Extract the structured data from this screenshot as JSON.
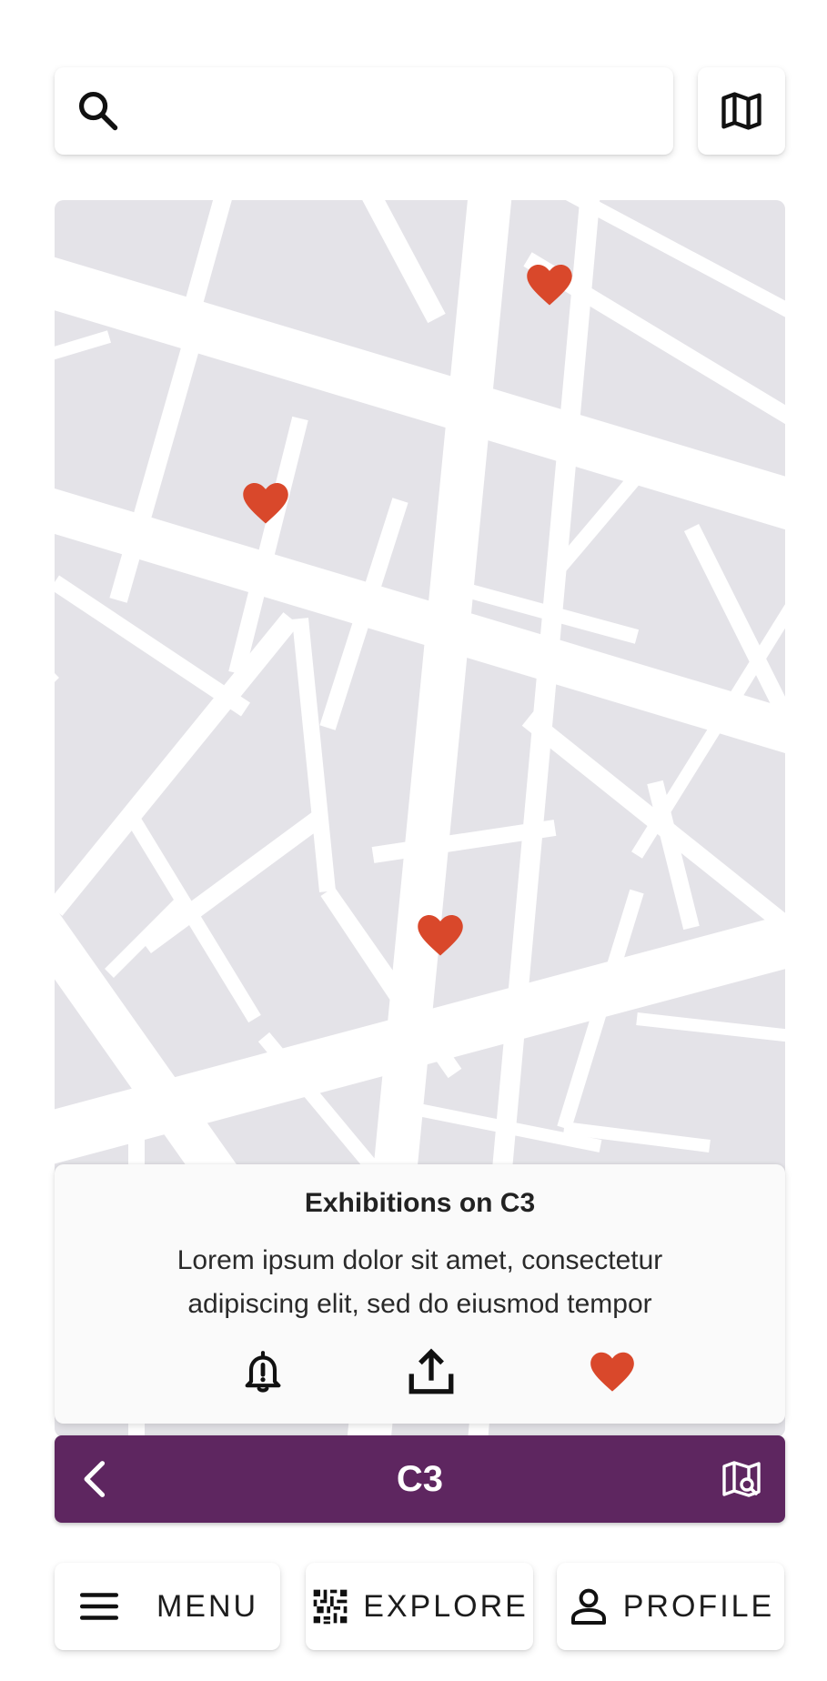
{
  "search": {
    "placeholder": "",
    "value": ""
  },
  "header": {
    "map_toggle_icon": "map-icon"
  },
  "map": {
    "markers": [
      {
        "icon": "heart-icon",
        "color": "#d9482b"
      },
      {
        "icon": "heart-icon",
        "color": "#d9482b"
      },
      {
        "icon": "heart-icon",
        "color": "#d9482b"
      }
    ]
  },
  "info_card": {
    "title": "Exhibitions on C3",
    "description": "Lorem ipsum dolor sit amet, consectetur adipiscing elit, sed do eiusmod tempor",
    "actions": [
      {
        "icon": "bell-alert-icon"
      },
      {
        "icon": "share-upload-icon"
      },
      {
        "icon": "heart-icon",
        "color": "#d9482b"
      }
    ]
  },
  "route_bar": {
    "title": "C3",
    "color": "#5e2660",
    "back_icon": "chevron-left-icon",
    "map_icon": "map-search-icon"
  },
  "bottom_nav": {
    "menu_label": "MENU",
    "explore_label": "EXPLORE",
    "profile_label": "PROFILE"
  }
}
